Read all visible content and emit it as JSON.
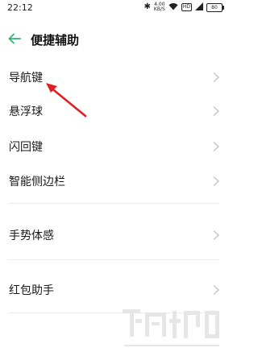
{
  "status_bar": {
    "time": "22:12",
    "network_speed_value": "4.00",
    "network_speed_unit": "KB/S",
    "hd_label": "HD",
    "battery_level": "80",
    "icons": [
      "bluetooth-icon",
      "wifi-icon",
      "hd-icon",
      "signal-icon",
      "battery-icon"
    ]
  },
  "header": {
    "title": "便捷辅助",
    "back_icon": "arrow-left-icon"
  },
  "menu": {
    "items": [
      {
        "label": "导航键"
      },
      {
        "label": "悬浮球"
      },
      {
        "label": "闪回键"
      },
      {
        "label": "智能侧边栏"
      },
      {
        "label": "手势体感"
      },
      {
        "label": "红包助手"
      }
    ]
  },
  "colors": {
    "accent": "#2bb673",
    "annotation_arrow": "#e02020",
    "chevron": "#c4c4c4",
    "divider": "#ececec"
  }
}
